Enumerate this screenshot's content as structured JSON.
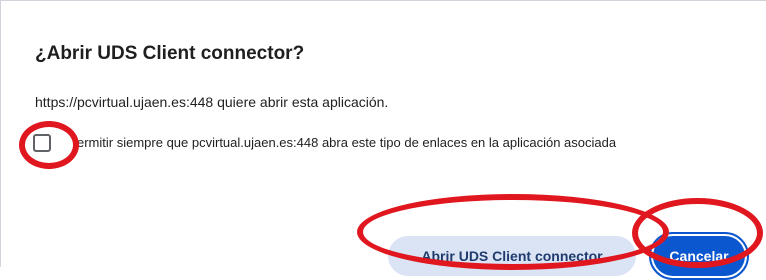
{
  "dialog": {
    "title": "¿Abrir UDS Client connector?",
    "message": "https://pcvirtual.ujaen.es:448 quiere abrir esta aplicación.",
    "checkbox_label": "ermitir siempre que pcvirtual.ujaen.es:448 abra este tipo de enlaces en la aplicación asociada",
    "checkbox_checked": false,
    "open_button_label": "Abrir UDS Client connector",
    "cancel_button_label": "Cancelar"
  },
  "colors": {
    "primary_blue": "#0b57d0",
    "tonal_button_bg": "#dbe4f5",
    "annotation_red": "#e0171f"
  }
}
